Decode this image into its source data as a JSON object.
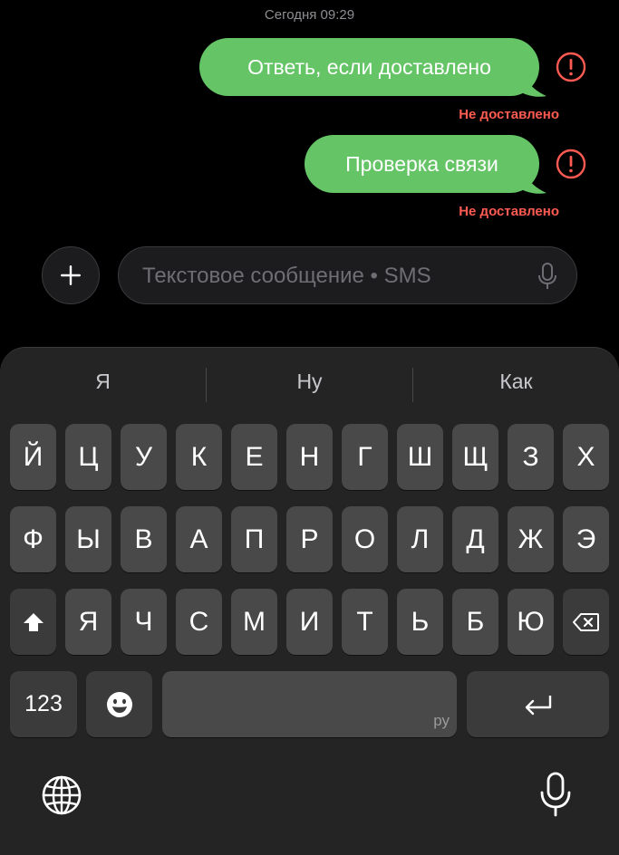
{
  "thread": {
    "timestamp": "Сегодня 09:29",
    "messages": [
      {
        "text": "Ответь, если доставлено",
        "status": "Не доставлено"
      },
      {
        "text": "Проверка связи",
        "status": "Не доставлено"
      }
    ]
  },
  "composer": {
    "placeholder": "Текстовое сообщение • SMS",
    "value": "",
    "attach_icon": "plus-icon",
    "mic_icon": "microphone-icon"
  },
  "keyboard": {
    "suggestions": [
      "Я",
      "Ну",
      "Как"
    ],
    "row1": [
      "Й",
      "Ц",
      "У",
      "К",
      "Е",
      "Н",
      "Г",
      "Ш",
      "Щ",
      "З",
      "Х"
    ],
    "row2": [
      "Ф",
      "Ы",
      "В",
      "А",
      "П",
      "Р",
      "О",
      "Л",
      "Д",
      "Ж",
      "Э"
    ],
    "row3": [
      "Я",
      "Ч",
      "С",
      "М",
      "И",
      "Т",
      "Ь",
      "Б",
      "Ю"
    ],
    "numbers_label": "123",
    "space_lang": "ру",
    "icons": {
      "shift": "shift-icon",
      "backspace": "backspace-icon",
      "emoji": "emoji-icon",
      "return": "return-icon",
      "globe": "globe-icon",
      "dictation": "microphone-icon"
    }
  },
  "colors": {
    "bubble": "#65c466",
    "error": "#ff5b52",
    "key": "#494949",
    "keyboard_bg": "#242424"
  }
}
